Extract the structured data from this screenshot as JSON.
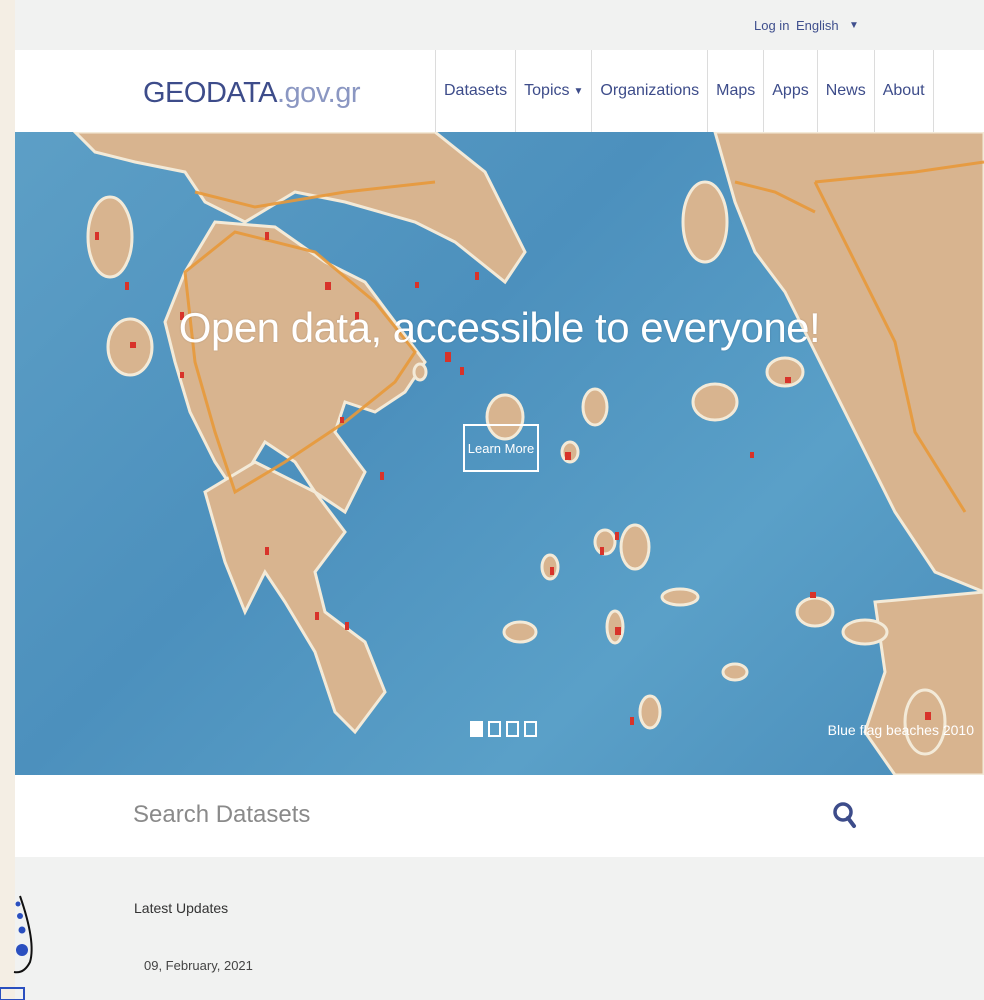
{
  "topbar": {
    "login": "Log in",
    "language": "English",
    "caret": "▼"
  },
  "brand": {
    "main": "GEODATA",
    "suffix": ".gov.gr"
  },
  "nav": {
    "items": [
      "Datasets",
      "Topics",
      "Organizations",
      "Maps",
      "Apps",
      "News",
      "About"
    ],
    "topics_caret": "▼"
  },
  "hero": {
    "title": "Open data, accessible to everyone!",
    "button": "Learn More",
    "caption": "Blue flag beaches 2010",
    "slide_count": 4,
    "active_slide": 1
  },
  "search": {
    "placeholder": "Search Datasets"
  },
  "updates": {
    "heading": "Latest Updates",
    "date": "09, February, 2021"
  },
  "colors": {
    "brand": "#3d4c8a",
    "brand_light": "#8b97c2",
    "sea": "#5198c3",
    "land": "#d9b38c",
    "road": "#e89a3a",
    "marker": "#d8332a"
  }
}
